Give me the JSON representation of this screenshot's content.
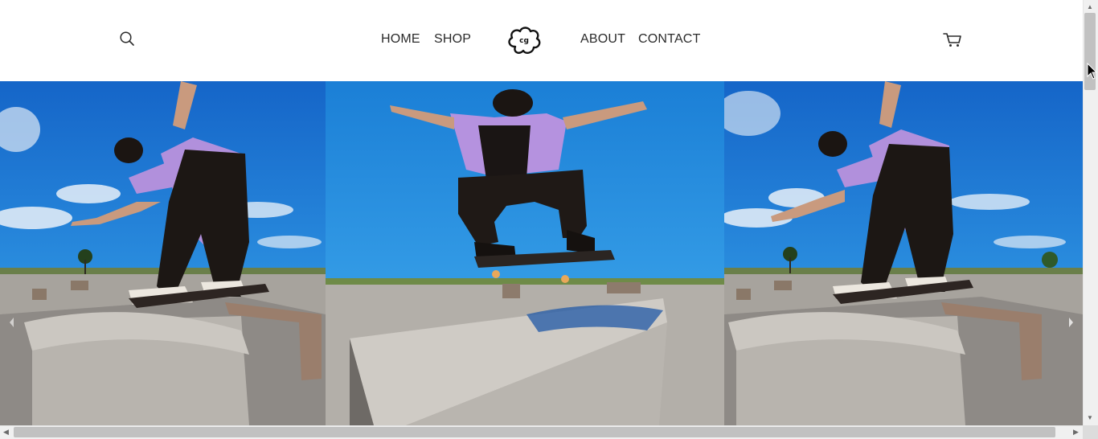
{
  "header": {
    "nav_left": [
      {
        "label": "HOME"
      },
      {
        "label": "SHOP"
      }
    ],
    "nav_right": [
      {
        "label": "ABOUT"
      },
      {
        "label": "CONTACT"
      }
    ],
    "icons": {
      "search": "search-icon",
      "logo": "cloud-logo",
      "cart": "cart-icon"
    }
  },
  "gallery": {
    "slides": [
      {
        "name": "skater-grind-left"
      },
      {
        "name": "skater-kickflip-center"
      },
      {
        "name": "skater-grind-right"
      }
    ],
    "arrows": [
      "chevron-left-icon",
      "chevron-right-icon"
    ]
  },
  "colors": {
    "nav_text": "#2a2a2a",
    "sky": "#1f8fdc",
    "shirt": "#b992e0",
    "concrete": "#9c9895"
  }
}
